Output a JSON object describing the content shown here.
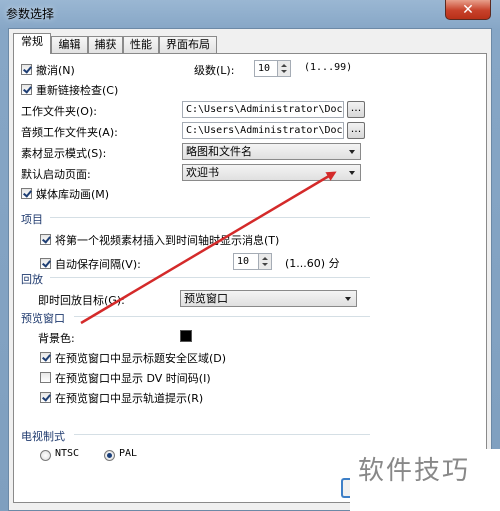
{
  "window": {
    "title": "参数选择",
    "close_glyph": "✕"
  },
  "tabs": [
    {
      "label": "常规",
      "active": true
    },
    {
      "label": "编辑"
    },
    {
      "label": "捕获"
    },
    {
      "label": "性能"
    },
    {
      "label": "界面布局"
    }
  ],
  "general": {
    "undo_label": "撤消(N)",
    "undo_checked": true,
    "levels_label": "级数(L):",
    "levels_value": "10",
    "levels_range": "(1...99)",
    "relink_label": "重新链接检查(C)",
    "relink_checked": true,
    "workfolder_label": "工作文件夹(O):",
    "workfolder_value": "C:\\Users\\Administrator\\Docu",
    "audiofolder_label": "音频工作文件夹(A):",
    "audiofolder_value": "C:\\Users\\Administrator\\Docu",
    "browse_label": "...",
    "display_mode_label": "素材显示模式(S):",
    "display_mode_value": "略图和文件名",
    "startup_label": "默认启动页面:",
    "startup_value": "欢迎书",
    "media_anim_label": "媒体库动画(M)",
    "media_anim_checked": true
  },
  "project": {
    "section": "项目",
    "insert_label": "将第一个视频素材插入到时间轴时显示消息(T)",
    "insert_checked": true,
    "autosave_label": "自动保存间隔(V):",
    "autosave_checked": true,
    "autosave_value": "10",
    "autosave_range": "(1...60) 分"
  },
  "playback": {
    "section": "回放",
    "target_label": "即时回放目标(G):",
    "target_value": "预览窗口"
  },
  "preview": {
    "section": "预览窗口",
    "bg_label": "背景色:",
    "bg_color": "#000000",
    "safe_label": "在预览窗口中显示标题安全区域(D)",
    "safe_checked": true,
    "dv_label": "在预览窗口中显示 DV 时间码(I)",
    "dv_checked": false,
    "track_label": "在预览窗口中显示轨道提示(R)",
    "track_checked": true
  },
  "tv": {
    "section": "电视制式",
    "ntsc_label": "NTSC",
    "pal_label": "PAL",
    "selected": "PAL"
  },
  "watermark": "软件技巧",
  "colors": {
    "annotation_arrow": "#d42a2a"
  }
}
